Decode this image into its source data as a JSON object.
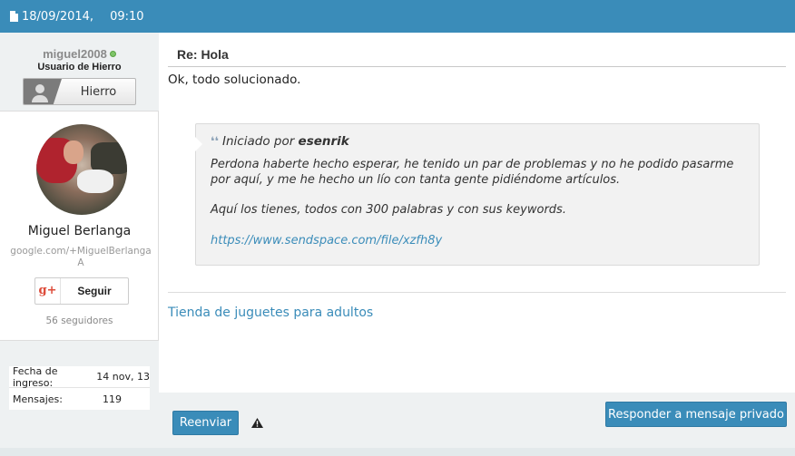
{
  "header": {
    "date": "18/09/2014,",
    "time": "09:10"
  },
  "user": {
    "username": "miguel2008",
    "title": "Usuario de Hierro",
    "rank_label": "Hierro"
  },
  "profile_card": {
    "name": "Miguel Berlanga",
    "gplus_url": "google.com/+MiguelBerlangaA",
    "follow_logo": "g+",
    "follow_label": "Seguir",
    "followers": "56 seguidores"
  },
  "user_info": [
    {
      "label": "Fecha de ingreso:",
      "value": "14 nov, 13"
    },
    {
      "label": "Mensajes:",
      "value": "119"
    }
  ],
  "post": {
    "title": "Re: Hola",
    "text": "Ok, todo solucionado.",
    "quote": {
      "prefix": "Iniciado por",
      "author": "esenrik",
      "paragraph1": "Perdona haberte hecho esperar, he tenido un par de problemas y no he podido pasarme por aquí, y me he hecho un lío con tanta gente pidiéndome artículos.",
      "paragraph2": "Aquí los tienes, todos con 300 palabras y con sus keywords.",
      "link": "https://www.sendspace.com/file/xzfh8y"
    },
    "signature_link": "Tienda de juguetes para adultos"
  },
  "actions": {
    "forward": "Reenviar",
    "reply_private": "Responder a mensaje privado"
  },
  "colors": {
    "accent": "#3a8cb9",
    "online": "#7ec468",
    "gplus": "#dd4b39"
  },
  "icons": [
    "document-icon",
    "online-status-icon",
    "user-avatar-icon",
    "quote-icon",
    "warning-icon"
  ]
}
